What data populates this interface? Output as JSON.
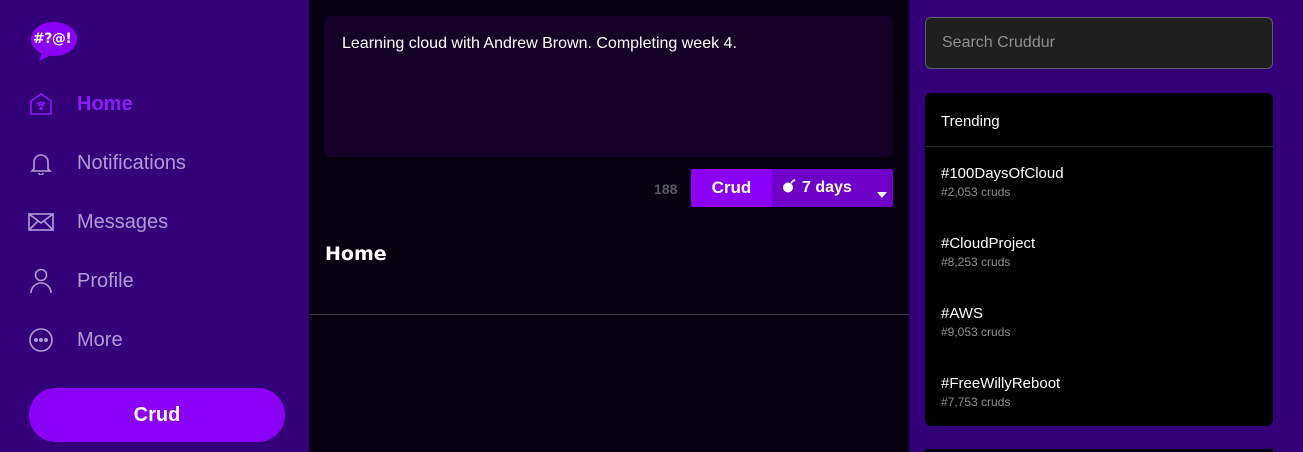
{
  "app": {
    "logo_text": "#?@!",
    "colors": {
      "sidebar": "#34007a",
      "accent": "#8b00f7",
      "main_bg": "#06000e"
    }
  },
  "sidebar": {
    "items": [
      {
        "label": "Home",
        "icon": "home-icon",
        "active": true
      },
      {
        "label": "Notifications",
        "icon": "bell-icon",
        "active": false
      },
      {
        "label": "Messages",
        "icon": "envelope-icon",
        "active": false
      },
      {
        "label": "Profile",
        "icon": "user-icon",
        "active": false
      },
      {
        "label": "More",
        "icon": "more-icon",
        "active": false
      }
    ],
    "crud_button": "Crud"
  },
  "compose": {
    "text": "Learning cloud with Andrew Brown. Completing week 4.",
    "remaining_count": "188",
    "submit_label": "Crud",
    "ttl_label": "7 days"
  },
  "feed": {
    "title": "Home"
  },
  "search": {
    "placeholder": "Search Cruddur"
  },
  "trending": {
    "title": "Trending",
    "items": [
      {
        "tag": "#100DaysOfCloud",
        "count": "#2,053 cruds"
      },
      {
        "tag": "#CloudProject",
        "count": "#8,253 cruds"
      },
      {
        "tag": "#AWS",
        "count": "#9,053 cruds"
      },
      {
        "tag": "#FreeWillyReboot",
        "count": "#7,753 cruds"
      }
    ]
  }
}
